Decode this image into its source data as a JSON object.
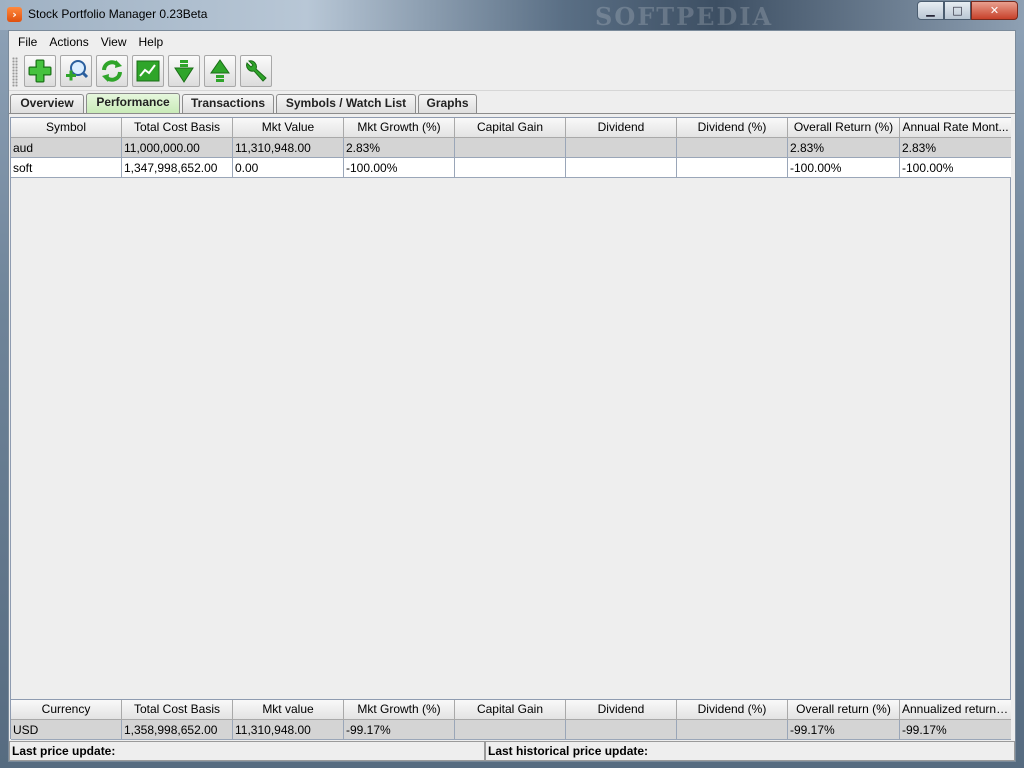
{
  "window": {
    "title": "Stock Portfolio Manager 0.23Beta",
    "watermark": "SOFTPEDIA",
    "min_label": "▁",
    "max_label": "□",
    "close_label": "✕"
  },
  "menu": {
    "file": "File",
    "actions": "Actions",
    "view": "View",
    "help": "Help"
  },
  "toolbar": {
    "icons": [
      "add-icon",
      "zoom-add-icon",
      "refresh-icon",
      "chart-icon",
      "download-icon",
      "upload-icon",
      "wrench-icon"
    ]
  },
  "tabs": {
    "overview": "Overview",
    "performance": "Performance",
    "transactions": "Transactions",
    "symbols": "Symbols / Watch List",
    "graphs": "Graphs",
    "active": "Performance"
  },
  "performance_table": {
    "columns": [
      "Symbol",
      "Total Cost Basis",
      "Mkt Value",
      "Mkt Growth (%)",
      "Capital Gain",
      "Dividend",
      "Dividend (%)",
      "Overall Return (%)",
      "Annual Rate Mont..."
    ],
    "rows": [
      [
        "aud",
        "11,000,000.00",
        "11,310,948.00",
        "2.83%",
        "",
        "",
        "",
        "2.83%",
        "2.83%"
      ],
      [
        "soft",
        "1,347,998,652.00",
        "0.00",
        "-100.00%",
        "",
        "",
        "",
        "-100.00%",
        "-100.00%"
      ]
    ]
  },
  "summary_table": {
    "columns": [
      "Currency",
      "Total Cost Basis",
      "Mkt value",
      "Mkt Growth (%)",
      "Capital Gain",
      "Dividend",
      "Dividend (%)",
      "Overall return (%)",
      "Annualized return (..."
    ],
    "rows": [
      [
        "USD",
        "1,358,998,652.00",
        "11,310,948.00",
        "-99.17%",
        "",
        "",
        "",
        "-99.17%",
        "-99.17%"
      ]
    ]
  },
  "status": {
    "last_price": "Last price update:",
    "last_historical": "Last historical price update:"
  },
  "colors": {
    "active_tab": "#c9ebb8",
    "selected_row": "#d4d4d4",
    "icon_green": "#2fa52a"
  }
}
